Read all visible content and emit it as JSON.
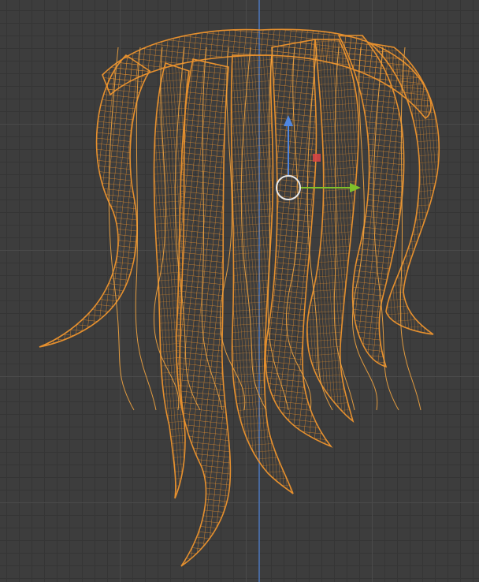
{
  "viewport": {
    "editor": "3D Viewport",
    "shading_mode": "wireframe",
    "background_color": "#3d3d3d",
    "grid_color": "#4a4a4a",
    "y_axis_color": "#4a6ea8"
  },
  "object": {
    "type": "hair-mesh",
    "selected": true,
    "wire_color": "#f0952e"
  },
  "gizmo": {
    "mode": "translate",
    "x_axis_color": "#7ec12a",
    "z_axis_color": "#4f86e0",
    "plane_handle_color": "#d64545",
    "origin_ring_color": "#e8e8e8"
  }
}
